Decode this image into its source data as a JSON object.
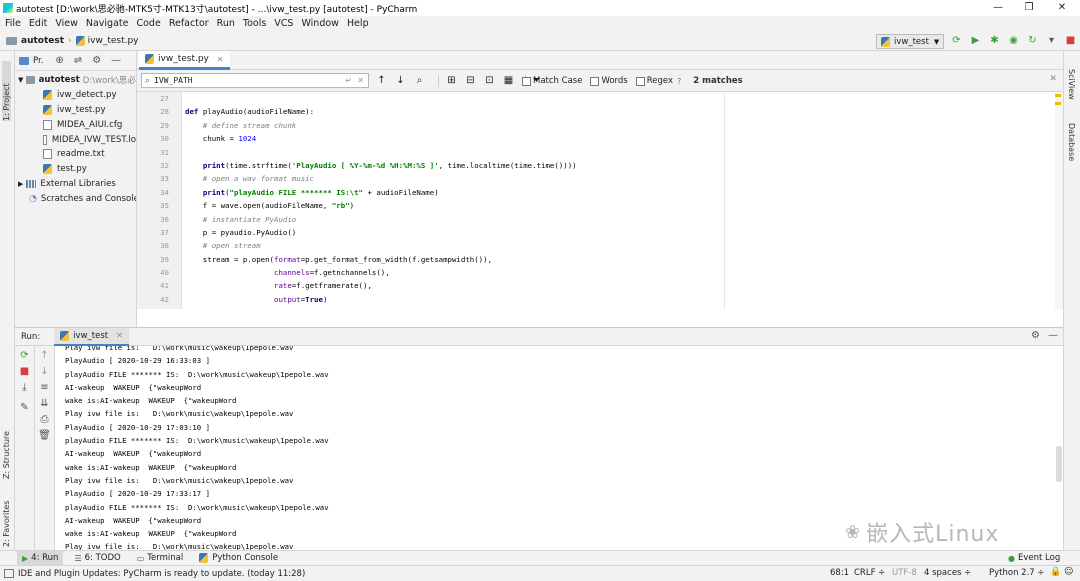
{
  "window": {
    "title": "autotest [D:\\work\\思必驰-MTK5寸-MTK13寸\\autotest] - ...\\ivw_test.py [autotest] - PyCharm",
    "minimize": "—",
    "maximize": "❐",
    "close": "✕"
  },
  "menu": [
    "File",
    "Edit",
    "View",
    "Navigate",
    "Code",
    "Refactor",
    "Run",
    "Tools",
    "VCS",
    "Window",
    "Help"
  ],
  "breadcrumb": {
    "project": "autotest",
    "file": "ivw_test.py"
  },
  "run_config": {
    "name": "ivw_test"
  },
  "project_panel": {
    "label": "Pr.",
    "root_name": "autotest",
    "root_path": "D:\\work\\思必",
    "files": [
      "ivw_detect.py",
      "ivw_test.py",
      "MIDEA_AIUI.cfg",
      "MIDEA_IVW_TEST.lo",
      "readme.txt",
      "test.py"
    ],
    "external": "External Libraries",
    "scratches": "Scratches and Consoles"
  },
  "left_stripe": {
    "project": "1: Project",
    "structure": "Z: Structure",
    "favorites": "2: Favorites"
  },
  "right_stripe": {
    "sciview": "SciView",
    "database": "Database"
  },
  "editor": {
    "tab": "ivw_test.py",
    "search_value": "IVW_PATH",
    "match_case": "Match Case",
    "words": "Words",
    "regex": "Regex",
    "help": "?",
    "matches": "2 matches",
    "line_numbers": [
      "27",
      "28",
      "29",
      "30",
      "31",
      "32",
      "33",
      "34",
      "35",
      "36",
      "37",
      "38",
      "39",
      "40",
      "41",
      "42"
    ]
  },
  "run_panel": {
    "label": "Run:",
    "tab": "ivw_test",
    "console": [
      "Play ivw file is:   D:\\work\\music\\wakeup\\1pepole.wav",
      "PlayAudio [ 2020-10-29 16:33:03 ]",
      "playAudio FILE ******* IS:  D:\\work\\music\\wakeup\\1pepole.wav",
      "AI-wakeup  WAKEUP  {\"wakeupWord",
      "wake is:AI-wakeup  WAKEUP  {\"wakeupWord",
      "Play ivw file is:   D:\\work\\music\\wakeup\\1pepole.wav",
      "PlayAudio [ 2020-10-29 17:03:10 ]",
      "playAudio FILE ******* IS:  D:\\work\\music\\wakeup\\1pepole.wav",
      "AI-wakeup  WAKEUP  {\"wakeupWord",
      "wake is:AI-wakeup  WAKEUP  {\"wakeupWord",
      "Play ivw file is:   D:\\work\\music\\wakeup\\1pepole.wav",
      "PlayAudio [ 2020-10-29 17:33:17 ]",
      "playAudio FILE ******* IS:  D:\\work\\music\\wakeup\\1pepole.wav",
      "AI-wakeup  WAKEUP  {\"wakeupWord",
      "wake is:AI-wakeup  WAKEUP  {\"wakeupWord",
      "Play ivw file is:   D:\\work\\music\\wakeup\\1pepole.wav"
    ]
  },
  "bottom_tabs": {
    "run": "4: Run",
    "todo": "6: TODO",
    "terminal": "Terminal",
    "python_console": "Python Console",
    "event_log": "Event Log"
  },
  "watermark": "嵌入式Linux",
  "status": {
    "message": "IDE and Plugin Updates: PyCharm is ready to update. (today 11:28)",
    "position": "68:1",
    "line_sep": "CRLF ÷",
    "encoding": "UTF-8",
    "indent": "4 spaces ÷",
    "interpreter": "Python 2.7 ÷"
  },
  "colors": {
    "keyword": "#000080",
    "string": "#008000",
    "comment": "#808080",
    "number": "#0000ff",
    "param": "#660099"
  }
}
